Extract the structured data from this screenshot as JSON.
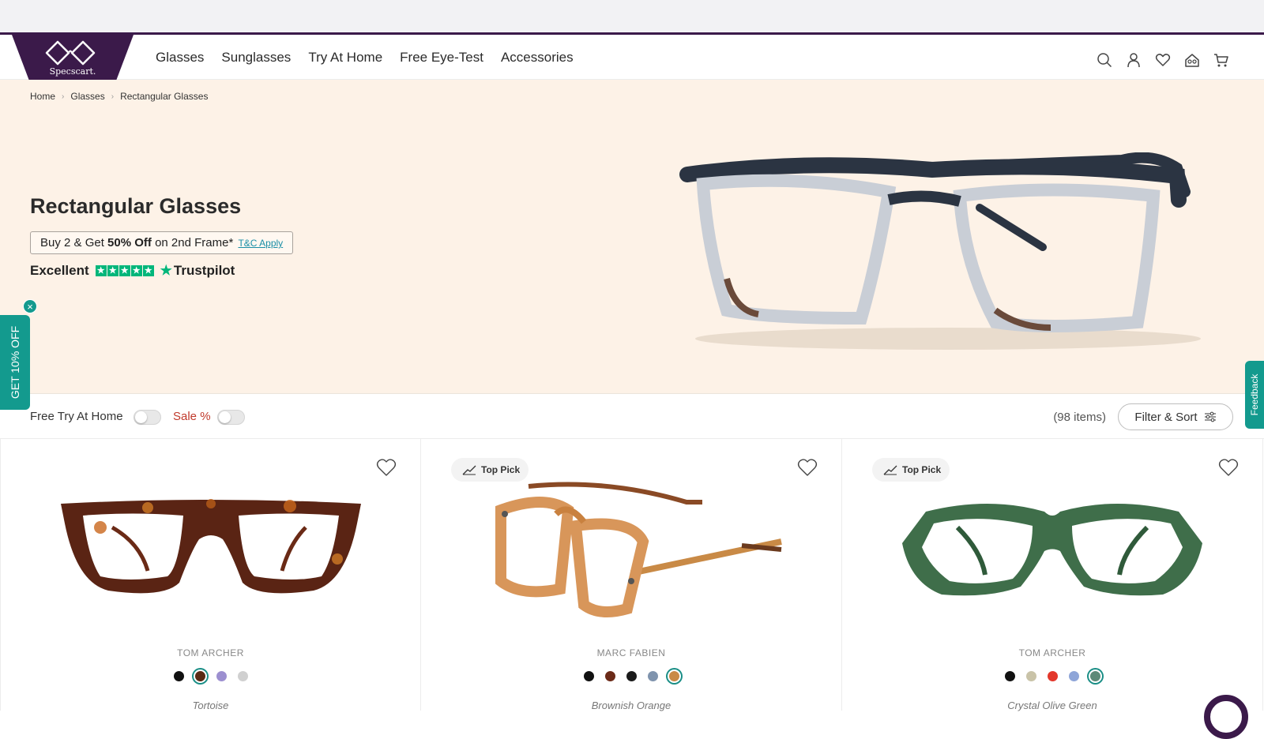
{
  "header": {
    "logo_text": "Specscart.",
    "nav": [
      "Glasses",
      "Sunglasses",
      "Try At Home",
      "Free Eye-Test",
      "Accessories"
    ],
    "icons": [
      "search-icon",
      "account-icon",
      "wishlist-icon",
      "try-at-home-icon",
      "cart-icon"
    ]
  },
  "breadcrumb": [
    "Home",
    "Glasses",
    "Rectangular Glasses"
  ],
  "hero": {
    "title": "Rectangular Glasses",
    "offer_prefix": "Buy 2 & Get ",
    "offer_bold": "50% Off",
    "offer_suffix": " on 2nd Frame*",
    "offer_link": "T&C Apply",
    "rating_label": "Excellent",
    "trustpilot": "Trustpilot"
  },
  "promo": {
    "tab_label": "GET 10% OFF",
    "close": "×"
  },
  "feedback": {
    "label": "Feedback"
  },
  "filters": {
    "try_home_label": "Free Try At Home",
    "sale_label": "Sale %",
    "count": "(98 items)",
    "filter_sort_label": "Filter & Sort"
  },
  "products": [
    {
      "badge": "",
      "brand": "TOM ARCHER",
      "color_name": "Tortoise",
      "swatches": [
        "#111111",
        "#5a2a14",
        "#9c8fd0",
        "#d0d0d0"
      ],
      "selected": 1
    },
    {
      "badge": "Top Pick",
      "brand": "MARC FABIEN",
      "color_name": "Brownish Orange",
      "swatches": [
        "#111111",
        "#6b2a18",
        "#1a1a1a",
        "#7f93ad",
        "#c98a46"
      ],
      "selected": 4
    },
    {
      "badge": "Top Pick",
      "brand": "TOM ARCHER",
      "color_name": "Crystal Olive Green",
      "swatches": [
        "#111111",
        "#c9c3a8",
        "#e3372b",
        "#8ea5d8",
        "#5d8a78"
      ],
      "selected": 4
    }
  ],
  "colors": {
    "brand_purple": "#3b1a4a",
    "teal": "#139a8e",
    "hero_bg": "#fdf2e7",
    "trustpilot_green": "#00b67a",
    "sale_red": "#c0392b"
  }
}
